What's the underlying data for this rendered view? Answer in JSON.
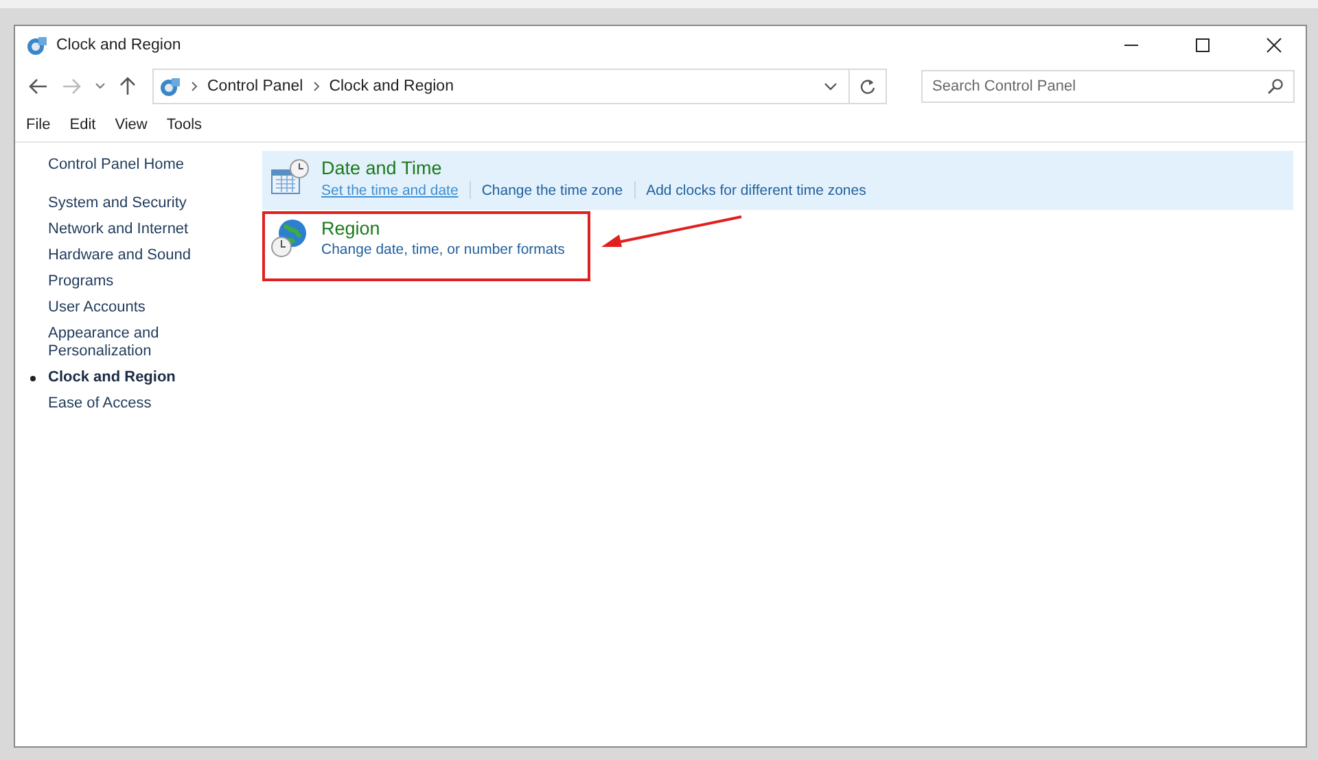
{
  "window": {
    "title": "Clock and Region"
  },
  "address_bar": {
    "crumbs": [
      "Control Panel",
      "Clock and Region"
    ]
  },
  "search": {
    "placeholder": "Search Control Panel"
  },
  "menu": [
    "File",
    "Edit",
    "View",
    "Tools"
  ],
  "sidebar": {
    "home": "Control Panel Home",
    "items": [
      {
        "label": "System and Security",
        "selected": false
      },
      {
        "label": "Network and Internet",
        "selected": false
      },
      {
        "label": "Hardware and Sound",
        "selected": false
      },
      {
        "label": "Programs",
        "selected": false
      },
      {
        "label": "User Accounts",
        "selected": false
      },
      {
        "label": "Appearance and Personalization",
        "selected": false
      },
      {
        "label": "Clock and Region",
        "selected": true
      },
      {
        "label": "Ease of Access",
        "selected": false
      }
    ]
  },
  "categories": [
    {
      "kind": "calendar",
      "title": "Date and Time",
      "highlighted": true,
      "annotated": false,
      "links": [
        {
          "label": "Set the time and date",
          "underlined": true
        },
        {
          "label": "Change the time zone",
          "underlined": false
        },
        {
          "label": "Add clocks for different time zones",
          "underlined": false
        }
      ]
    },
    {
      "kind": "globe",
      "title": "Region",
      "highlighted": false,
      "annotated": true,
      "links": [
        {
          "label": "Change date, time, or number formats",
          "underlined": false
        }
      ]
    }
  ]
}
